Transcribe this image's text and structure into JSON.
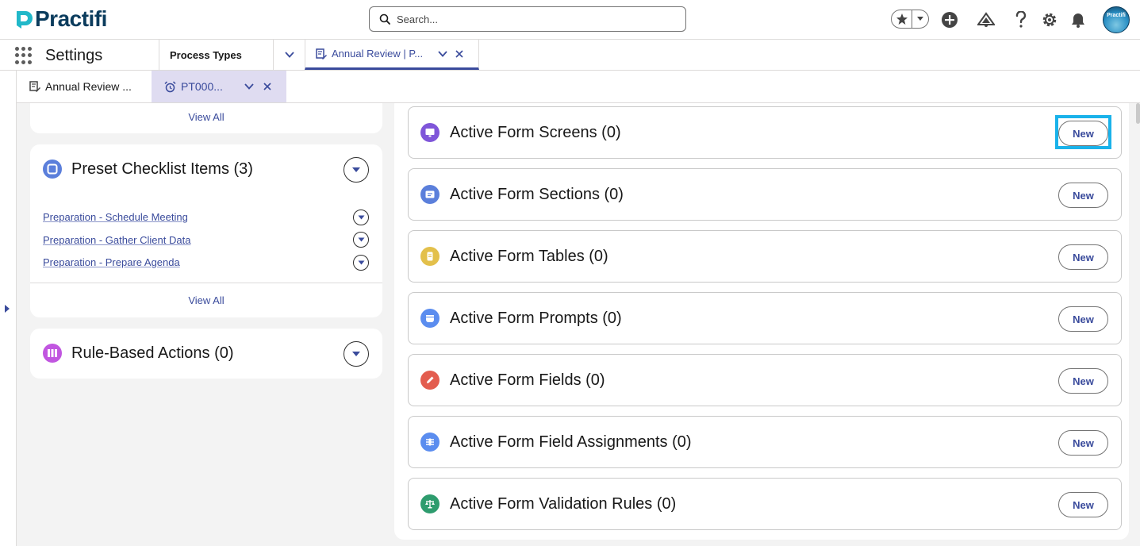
{
  "header": {
    "logo_text": "Practifi",
    "search_placeholder": "Search...",
    "avatar_text": "Practifi",
    "icons": [
      "star-icon",
      "chevron-down-icon",
      "plus-circle-icon",
      "trailhead-icon",
      "help-icon",
      "gear-icon",
      "bell-icon"
    ]
  },
  "nav": {
    "app_name": "Settings",
    "tabs": [
      {
        "label": "Process Types"
      },
      {
        "label": "Annual Review | P..."
      }
    ]
  },
  "subtabs": [
    {
      "label": "Annual Review ..."
    },
    {
      "label": "PT000..."
    }
  ],
  "left": {
    "top_card": {
      "view_all": "View All"
    },
    "preset_card": {
      "title": "Preset Checklist Items (3)",
      "items": [
        {
          "label": "Preparation - Schedule Meeting"
        },
        {
          "label": "Preparation - Gather Client Data"
        },
        {
          "label": "Preparation - Prepare Agenda"
        }
      ],
      "view_all": "View All"
    },
    "rule_card": {
      "title": "Rule-Based Actions (0)"
    }
  },
  "right": {
    "cards": [
      {
        "title": "Active Form Screens (0)",
        "button": "New",
        "icon": "monitor-icon",
        "color": "#7f56d9"
      },
      {
        "title": "Active Form Sections (0)",
        "button": "New",
        "icon": "section-icon",
        "color": "#5b7fdb"
      },
      {
        "title": "Active Form Tables (0)",
        "button": "New",
        "icon": "table-icon",
        "color": "#e3c04b"
      },
      {
        "title": "Active Form Prompts (0)",
        "button": "New",
        "icon": "prompt-icon",
        "color": "#5b8def"
      },
      {
        "title": "Active Form Fields (0)",
        "button": "New",
        "icon": "pencil-icon",
        "color": "#e35d4f"
      },
      {
        "title": "Active Form Field Assignments (0)",
        "button": "New",
        "icon": "assignment-icon",
        "color": "#5b8def"
      },
      {
        "title": "Active Form Validation Rules (0)",
        "button": "New",
        "icon": "scales-icon",
        "color": "#2e9c6e"
      }
    ]
  },
  "colors": {
    "brand": "#0b3c5d",
    "link": "#3a4b9c",
    "highlight": "#1ab2ea",
    "background": "#f3f3f3"
  }
}
